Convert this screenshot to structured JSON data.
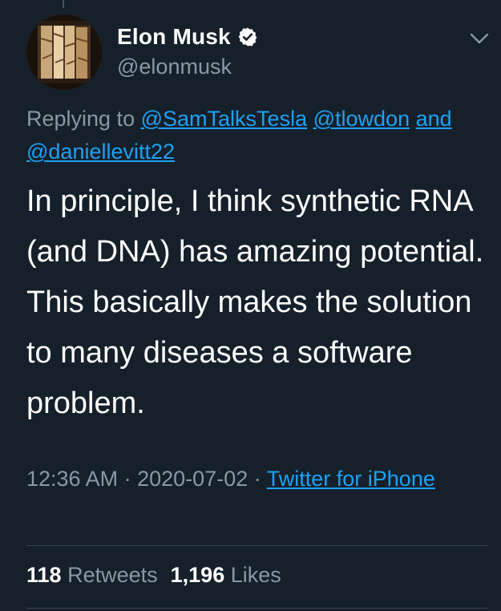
{
  "author": {
    "display_name": "Elon Musk",
    "handle": "@elonmusk",
    "verified": true
  },
  "reply": {
    "prefix": "Replying to",
    "mention_1": "@SamTalksTesla",
    "mention_2": "@tlowdon",
    "conjunction": "and",
    "mention_3": "@daniellevitt22"
  },
  "tweet": {
    "text": "In principle, I think synthetic RNA (and DNA) has amazing potential. This basically makes the solution to many diseases a software problem."
  },
  "meta": {
    "time": "12:36 AM",
    "separator": "·",
    "date": "2020-07-02",
    "source": "Twitter for iPhone"
  },
  "stats": {
    "retweets_count": "118",
    "retweets_label": "Retweets",
    "likes_count": "1,196",
    "likes_label": "Likes"
  },
  "colors": {
    "background": "#15202b",
    "link": "#1da1f2",
    "secondary_text": "#8899a6",
    "verified_badge": "#ffffff"
  },
  "icons": {
    "verified": "verified-badge-icon",
    "menu": "chevron-down-icon"
  }
}
